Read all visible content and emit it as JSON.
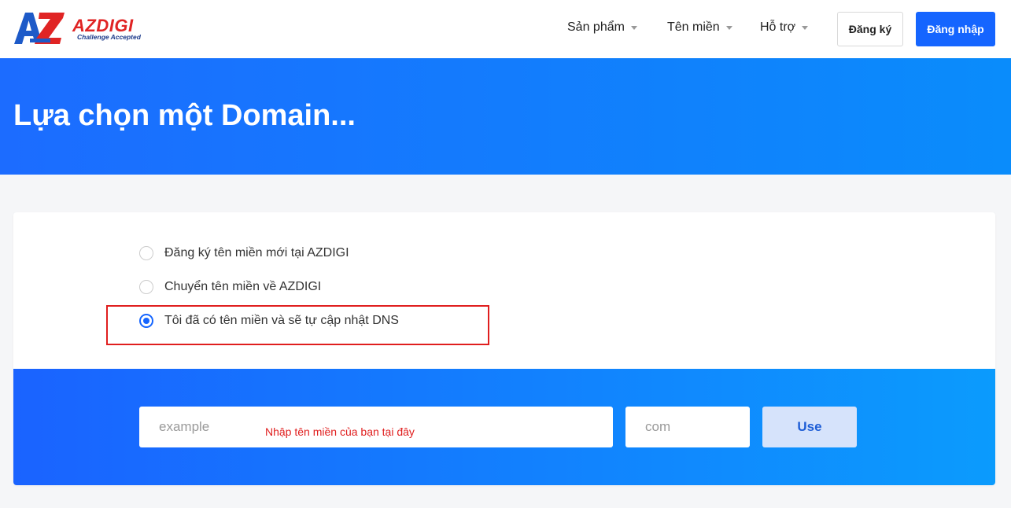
{
  "logo": {
    "text": "AZDIGI",
    "tagline": "Challenge Accepted"
  },
  "nav": {
    "items": [
      {
        "label": "Sản phẩm"
      },
      {
        "label": "Tên miền"
      },
      {
        "label": "Hỗ trợ"
      }
    ],
    "register_label": "Đăng ký",
    "login_label": "Đăng nhập"
  },
  "hero": {
    "title": "Lựa chọn một Domain..."
  },
  "domain_options": [
    {
      "label": "Đăng ký tên miền mới tại AZDIGI",
      "selected": false
    },
    {
      "label": "Chuyển tên miền về AZDIGI",
      "selected": false
    },
    {
      "label": "Tôi đã có tên miền và sẽ tự cập nhật DNS",
      "selected": true
    }
  ],
  "search": {
    "domain_placeholder": "example",
    "tld_placeholder": "com",
    "use_label": "Use",
    "annotation": "Nhập tên miền của bạn tại đây"
  },
  "colors": {
    "primary": "#1565ff",
    "annotation_red": "#e01e1e",
    "logo_red": "#e02424",
    "logo_blue": "#1d3a8a"
  }
}
